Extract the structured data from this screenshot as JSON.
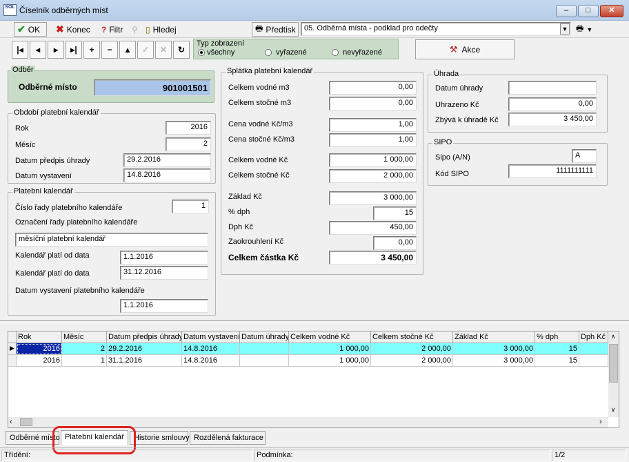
{
  "window": {
    "title": "Číselník odběrných míst",
    "logo_text": "SOL"
  },
  "toolbar": {
    "ok": "OK",
    "konec": "Konec",
    "filtr": "Filtr",
    "hledej": "Hledej",
    "predtisk": "Předtisk",
    "report_select": "05. Odběrná místa - podklad pro odečty"
  },
  "nav": {
    "first": "|◂",
    "prev": "◂",
    "next": "▸",
    "last": "▸|",
    "add": "+",
    "delete": "−",
    "up": "▴",
    "check": "✓",
    "cancel": "✕",
    "refresh": "↻"
  },
  "typ": {
    "label": "Typ zobrazení",
    "options": [
      "všechny",
      "vyřazené",
      "nevyřazené"
    ],
    "selected": "všechny"
  },
  "akce": "Akce",
  "odber": {
    "group": "Odběr",
    "label": "Odběrné místo",
    "value": "901001501"
  },
  "obdobi": {
    "group": "Období platební kalendář",
    "rok_label": "Rok",
    "rok": "2016",
    "mesic_label": "Měsíc",
    "mesic": "2",
    "predpis_label": "Datum předpis úhrady",
    "predpis": "29.2.2016",
    "vystaveni_label": "Datum vystavení",
    "vystaveni": "14.8.2016"
  },
  "kalendar": {
    "group": "Platební kalendář",
    "cislo_label": "Číslo řady platebního kalendáře",
    "cislo": "1",
    "oznaceni_label": "Označení řady platebního kalendáře",
    "oznaceni": "měsíční platební kalendář",
    "od_label": "Kalendář platí od data",
    "od": "1.1.2016",
    "do_label": "Kalendář platí do data",
    "do": "31.12.2016",
    "vystaveni_label": "Datum vystavení platebního kalendáře",
    "vystaveni": "1.1.2016"
  },
  "splatka": {
    "group": "Splátka platební kalendář",
    "vodne_m3_label": "Celkem vodné m3",
    "vodne_m3": "0,00",
    "stocne_m3_label": "Celkem stočné m3",
    "stocne_m3": "0,00",
    "cena_vodne_label": "Cena vodné Kč/m3",
    "cena_vodne": "1,00",
    "cena_stocne_label": "Cena stočné Kč/m3",
    "cena_stocne": "1,00",
    "vodne_kc_label": "Celkem vodné Kč",
    "vodne_kc": "1 000,00",
    "stocne_kc_label": "Celkem stočné Kč",
    "stocne_kc": "2 000,00",
    "zaklad_label": "Základ Kč",
    "zaklad": "3 000,00",
    "dph_pct_label": "% dph",
    "dph_pct": "15",
    "dph_label": "Dph Kč",
    "dph": "450,00",
    "zaokr_label": "Zaokrouhlení Kč",
    "zaokr": "0,00",
    "celkem_label": "Celkem částka Kč",
    "celkem": "3 450,00"
  },
  "uhrada": {
    "group": "Úhrada",
    "datum_label": "Datum úhrady",
    "datum": "",
    "uhrazeno_label": "Uhrazeno Kč",
    "uhrazeno": "0,00",
    "zbyva_label": "Zbývá k úhradě Kč",
    "zbyva": "3 450,00"
  },
  "sipo": {
    "group": "SIPO",
    "sipo_label": "Sipo (A/N)",
    "sipo": "A",
    "kod_label": "Kód SIPO",
    "kod": "1111111111"
  },
  "grid": {
    "columns": [
      "Rok",
      "Měsíc",
      "Datum předpis úhrady",
      "Datum vystavení",
      "Datum úhrady",
      "Celkem vodné Kč",
      "Celkem stočné Kč",
      "Základ Kč",
      "% dph",
      "Dph Kč"
    ],
    "rows": [
      [
        "2016",
        "2",
        "29.2.2016",
        "14.8.2016",
        "",
        "1 000,00",
        "2 000,00",
        "3 000,00",
        "15",
        ""
      ],
      [
        "2016",
        "1",
        "31.1.2016",
        "14.8.2016",
        "",
        "1 000,00",
        "2 000,00",
        "3 000,00",
        "15",
        ""
      ]
    ]
  },
  "tabs": [
    "Odběrné místo",
    "Platební kalendář",
    "Historie smlouvy",
    "Rozdělená fakturace"
  ],
  "active_tab": "Platební kalendář",
  "status": {
    "trideni": "Třídění:",
    "podminka": "Podmínka:",
    "pager": "1/2"
  },
  "colors": {
    "selected_row": "#80ffff",
    "odber_field": "#a9c6ea",
    "typ_box": "#c8dcc8",
    "highlight": "#e0211f"
  }
}
